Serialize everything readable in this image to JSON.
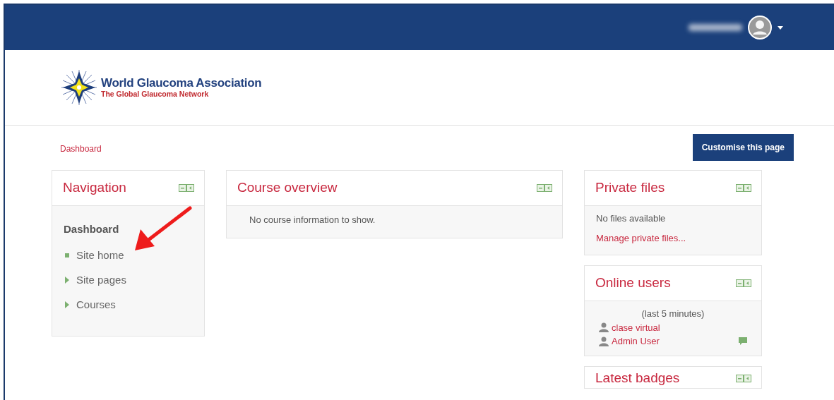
{
  "logo": {
    "title": "World Glaucoma Association",
    "subtitle": "The Global Glaucoma Network"
  },
  "breadcrumb": [
    "Dashboard"
  ],
  "customise_button": "Customise this page",
  "navigation": {
    "title": "Navigation",
    "items": [
      {
        "label": "Dashboard",
        "kind": "heading",
        "children": [
          {
            "label": "Site home",
            "kind": "leaf"
          },
          {
            "label": "Site pages",
            "kind": "branch",
            "expanded": false
          },
          {
            "label": "Courses",
            "kind": "branch",
            "expanded": false
          }
        ]
      }
    ]
  },
  "course_overview": {
    "title": "Course overview",
    "message": "No course information to show."
  },
  "private_files": {
    "title": "Private files",
    "message": "No files available",
    "link": "Manage private files..."
  },
  "online_users": {
    "title": "Online users",
    "period": "(last 5 minutes)",
    "users": [
      {
        "name": "clase virtual",
        "message_icon": false
      },
      {
        "name": "Admin User",
        "message_icon": true
      }
    ]
  },
  "latest_badges": {
    "title": "Latest badges"
  }
}
